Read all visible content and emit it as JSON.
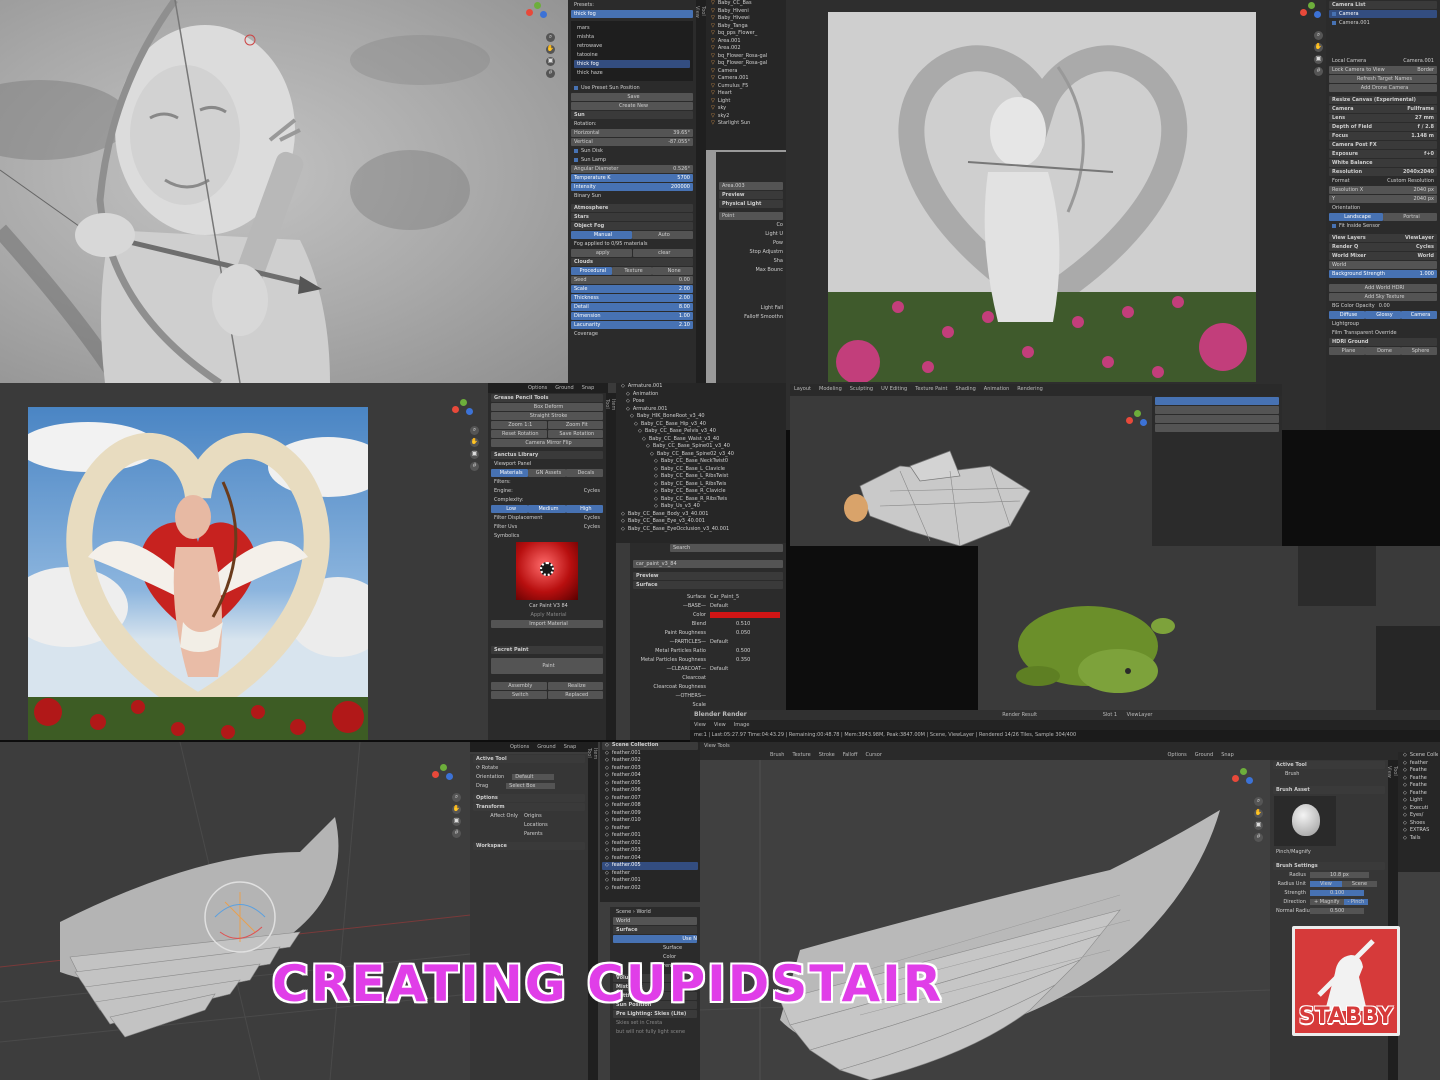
{
  "title": "CREATING CUPIDSTAIR",
  "logo_text": "STABBY",
  "colors": {
    "title": "#e03ee8",
    "title_outline": "#ffffff",
    "logo": "#d63a3a",
    "accent": "#4772b3"
  },
  "sky_panel": {
    "presets_label": "Presets:",
    "preset_selected": "thick fog",
    "preset_list": [
      "mars",
      "mishta",
      "retrowave",
      "tatooine",
      "thick fog",
      "thick haze"
    ],
    "use_preset_sun": "Use Preset Sun Position",
    "save": "Save",
    "create_new": "Create New",
    "sun": "Sun",
    "rotation": "Rotation:",
    "horizontal": "Horizontal",
    "horizontal_v": "39.65°",
    "vertical": "Vertical",
    "vertical_v": "-87.055°",
    "sun_disk": "Sun Disk",
    "sun_lamp": "Sun Lamp",
    "angular": "Angular Diameter",
    "angular_v": "0.526°",
    "temp": "Temperature K",
    "temp_v": "5700",
    "intensity": "Intensity",
    "intensity_v": "200000",
    "binary": "Binary Sun",
    "atmosphere": "Atmosphere",
    "stars": "Stars",
    "object_fog": "Object Fog",
    "manual": "Manual",
    "auto": "Auto",
    "fog_note": "Fog applied to 0/95 materials",
    "apply": "apply",
    "clear": "clear",
    "clouds": "Clouds",
    "procedural": "Procedural",
    "texture": "Texture",
    "none": "None",
    "seed": "Seed",
    "seed_v": "0.00",
    "scale": "Scale",
    "scale_v": "2.00",
    "thickness": "Thickness",
    "thickness_v": "2.00",
    "detail": "Detail",
    "detail_v": "8.00",
    "dimension": "Dimension",
    "dimension_v": "1.00",
    "lacunarity": "Lacunarity",
    "lacunarity_v": "2.10",
    "coverage": "Coverage"
  },
  "outliner1": [
    "Baby_CC_Bas",
    "Baby_Hiveni",
    "Baby_Hivewi",
    "Baby_Tanga",
    "bq_pps_Flower_",
    "Area.001",
    "Area.002",
    "bq_Flower_Rosa-gal",
    "bq_Flower_Rosa-gal",
    "Camera",
    "Camera.001",
    "Cumulus_F5",
    "Heart",
    "Light",
    "sky",
    "sky2",
    "Starlight Sun"
  ],
  "light_panel": {
    "object": "Area.003",
    "preview": "Preview",
    "physical": "Physical Light",
    "point": "Point",
    "rows": [
      "Co",
      "Light U",
      "Pow",
      "Stop Adjustm",
      "Sha",
      "Max Bounc",
      "Light Fall",
      "Falloff Smoothn"
    ]
  },
  "camera_panel": {
    "camera_list": "Camera List",
    "camera": "Camera",
    "camera_001": "Camera.001",
    "local_camera": "Local Camera",
    "local_v": "Camera.001",
    "lock": "Lock Camera to View",
    "border": "Border",
    "refresh": "Refresh Target Names",
    "add_drone": "Add Drone Camera",
    "resize": "Resize Canvas (Experimental)",
    "camera_h": "Camera",
    "fullframe": "Fullframe",
    "lens": "Lens",
    "lens_v": "27 mm",
    "dof": "Depth of Field",
    "dof_v": "f / 2.8",
    "focus": "Focus",
    "focus_v": "1.148 m",
    "post_fx": "Camera Post FX",
    "exposure": "Exposure",
    "exposure_v": "f+0",
    "wb": "White Balance",
    "resolution": "Resolution",
    "resolution_v": "2040x2040",
    "format": "Format",
    "format_v": "Custom Resolution",
    "res_x": "Resolution X",
    "res_x_v": "2040 px",
    "res_y": "Y",
    "res_y_v": "2040 px",
    "orientation": "Orientation",
    "landscape": "Landscape",
    "portrait": "Portrai",
    "fit": "Fit Inside Sensor",
    "view_layers": "View Layers",
    "view_layer_v": "ViewLayer",
    "render_q": "Render Q",
    "cycles": "Cycles",
    "world_mixer": "World Mixer",
    "world_v": "World",
    "world": "World",
    "bg_strength": "Background Strength",
    "bg_strength_v": "1.000",
    "add_hdri": "Add World HDRI",
    "add_sky": "Add Sky Texture",
    "bg_opacity": "BG Color Opacity",
    "bg_opacity_v": "0.00",
    "diffuse": "Diffuse",
    "glossy": "Glossy",
    "camera_btn": "Camera",
    "lightgroup": "Lightgroup",
    "film": "Film Transparent Override",
    "hdri_ground": "HDRI Ground",
    "plane": "Plane",
    "dome": "Dome",
    "sphere": "Sphere"
  },
  "gp_panel": {
    "options": "Options",
    "ground": "Ground",
    "snap": "Snap",
    "gp_tools": "Grease Pencil Tools",
    "box_deform": "Box Deform",
    "straight": "Straight Stroke",
    "zoom11": "Zoom 1:1",
    "zoom_fit": "Zoom Fit",
    "reset_rot": "Reset Rotation",
    "save_rot": "Save Rotation",
    "mirror": "Camera Mirror Flip",
    "sanctus": "Sanctus Library",
    "viewport_panel": "Viewport Panel",
    "materials": "Materials",
    "gn": "GN Assets",
    "decals": "Decals",
    "filters": "Filters:",
    "engine": "Engine:",
    "engine_v": "Cycles",
    "complexity": "Complexity:",
    "low": "Low",
    "medium": "Medium",
    "high": "High",
    "filter_disp": "Filter Displacement",
    "filter_disp_v": "Cycles",
    "filter_uvs": "Filter Uvs",
    "filter_uvs_v": "Cycles",
    "symbolics": "Symbolics",
    "material_name": "Car Paint V3 84",
    "apply_mat": "Apply Material",
    "import_mat": "Import Material",
    "secret_paint": "Secret Paint",
    "paint": "Paint",
    "assembly": "Assembly",
    "realize": "Realize",
    "switch": "Switch",
    "replaced": "Replaced"
  },
  "outliner2": [
    "Armature.001",
    "Animation",
    "Pose",
    "Armature.001",
    "Baby_HIK_BoneRoot_v3_40",
    "Baby_CC_Base_Hip_v3_40",
    "Baby_CC_Base_Pelvis_v3_40",
    "Baby_CC_Base_Waist_v3_40",
    "Baby_CC_Base_Spine01_v3_40",
    "Baby_CC_Base_Spine02_v3_40",
    "Baby_CC_Base_NeckTwist0",
    "Baby_CC_Base_L_Clavicle",
    "Baby_CC_Base_L_RibsTwist",
    "Baby_CC_Base_L_RibsTwis",
    "Baby_CC_Base_R_Clavicle",
    "Baby_CC_Base_R_RibsTwis",
    "Baby_Us_v3_40",
    "Baby_CC_Base_Body_v3_40.001",
    "Baby_CC_Base_Eye_v3_40.001",
    "Baby_CC_Base_EyeOcclusion_v3_40.001"
  ],
  "material_panel": {
    "search": "Search",
    "material": "car_paint_v3_84",
    "preview": "Preview",
    "surface": "Surface",
    "surface_v": "Car_Paint_5",
    "base": "—BASE—",
    "base_v": "Default",
    "color": "Color",
    "blend": "Blend",
    "blend_v": "0.510",
    "paint_rough": "Paint Roughness",
    "paint_rough_v": "0.050",
    "particles": "—PARTICLES—",
    "particles_v": "Default",
    "metal_ratio": "Metal Particles Ratio",
    "metal_ratio_v": "0.500",
    "metal_rough": "Metal Particles Roughness",
    "metal_rough_v": "0.350",
    "clearcoat": "—CLEARCOAT—",
    "clearcoat_v": "Default",
    "clearcoat_s": "Clearcoat",
    "clearcoat_r": "Clearcoat Roughness",
    "others": "—OTHERS—",
    "scale": "Scale"
  },
  "render_window": {
    "title": "Blender Render",
    "menu": [
      "View",
      "View",
      "Image"
    ],
    "status": "me:1 | Last:05:27.97 Time:04:43.29 | Remaining:00:48.78 | Mem:3843.98M, Peak:3847.00M | Scene, ViewLayer | Rendered 14/26 Tiles, Sample 304/400",
    "render_result": "Render Result",
    "slot": "Slot 1",
    "view_layer": "ViewLayer"
  },
  "wing_left": {
    "options": "Options",
    "ground": "Ground",
    "snap": "Snap",
    "active_tool": "Active Tool",
    "rotate": "Rotate",
    "orientation": "Orientation",
    "orientation_v": "Default",
    "drag": "Drag",
    "drag_v": "Select Box",
    "options_h": "Options",
    "transform": "Transform",
    "affect_only": "Affect Only",
    "origins": "Origins",
    "locations": "Locations",
    "parents": "Parents",
    "workspace": "Workspace"
  },
  "outliner3": {
    "header": "Scene Collection",
    "items": [
      "feather.001",
      "feather.002",
      "feather.003",
      "feather.004",
      "feather.005",
      "feather.006",
      "feather.007",
      "feather.008",
      "feather.009",
      "feather.010",
      "feather",
      "feather.001",
      "feather.002",
      "feather.003",
      "feather.004",
      "feather.005",
      "feather",
      "feather.001",
      "feather.002"
    ],
    "selected_index": 15
  },
  "world_panel": {
    "scene": "Scene",
    "world": "World",
    "world_name": "World",
    "surface_h": "Surface",
    "use_nodes": "Use N",
    "surface": "Surface",
    "color": "Color",
    "strength": "Strength",
    "volume": "Volume",
    "mist": "Mist Pass",
    "settings": "Settings",
    "sun_position": "Sun Position",
    "pre_lighting": "Pre Lighting: Skies (Lite)",
    "sky_note1": "Skies set in Cresta",
    "sky_note2": "but will not fully light scene"
  },
  "sculpt": {
    "menus": [
      "Brush",
      "Texture",
      "Stroke",
      "Falloff",
      "Cursor"
    ],
    "tools": "View Tools",
    "options": "Options",
    "ground": "Ground",
    "snap": "Snap",
    "active_tool": "Active Tool",
    "brush": "Brush",
    "brush_asset": "Brush Asset",
    "brush_name": "Pinch/Magnify",
    "brush_settings": "Brush Settings",
    "radius": "Radius",
    "radius_v": "10.8 px",
    "radius_unit": "Radius Unit",
    "view": "View",
    "scene": "Scene",
    "strength": "Strength",
    "strength_v": "0.100",
    "direction": "Direction",
    "magnify": "+ Magnify",
    "pinch": "- Pinch",
    "normal_radius": "Normal Radius",
    "normal_radius_v": "0.500"
  },
  "sculpt_outliner": [
    "Scene Colle",
    "feather",
    "Feathe",
    "Feathe",
    "Feathe",
    "Feathe",
    "Light",
    "Executi",
    "Eyes/",
    "Shoes",
    "EXTRAS",
    "Tails"
  ]
}
